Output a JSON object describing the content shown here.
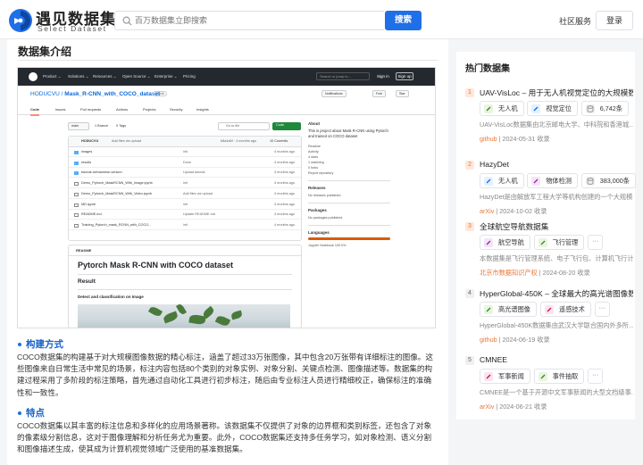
{
  "header": {
    "brand_cn": "遇见数据集",
    "brand_en": "Select Dataset",
    "search_placeholder": "百万数据集立即搜索",
    "search_button": "搜索",
    "community": "社区服务",
    "login": "登录"
  },
  "main": {
    "section_title": "数据集介绍",
    "github": {
      "menu": [
        "Product ⌄",
        "Solutions ⌄",
        "Resources ⌄",
        "Open Source ⌄",
        "Enterprise ⌄",
        "Pricing"
      ],
      "search": "Search or jump to...",
      "sign_in": "Sign in",
      "sign_up": "Sign up",
      "owner": "HODUCVU",
      "repo": "Mask_R-CNN_with_COCO_dataset",
      "visibility": "Public",
      "notifications": "Notifications",
      "fork": "Fork",
      "star": "Star",
      "tabs": [
        "Code",
        "Issues",
        "Pull requests",
        "Actions",
        "Projects",
        "Security",
        "Insights"
      ],
      "branch": "main",
      "branches": "1 Branch",
      "tags": "0 Tags",
      "goto_file": "Go to file",
      "code_button": "Code",
      "commit_author": "HODUCVU",
      "commit_msg": "Add files via upload",
      "commit_hash": "b8a4a5f · 4 months ago",
      "commits": "10 Commits",
      "files": [
        {
          "name": "images",
          "msg": "init",
          "time": "4 months ago"
        },
        {
          "name": "results",
          "msg": "Done",
          "time": "4 months ago"
        },
        {
          "name": "tutorial-vietnamese-version",
          "msg": "Upload tutorial",
          "time": "4 months ago"
        },
        {
          "name": "Demo_Pytorch_MaskRCNN_With_Image.ipynb",
          "msg": "init",
          "time": "4 months ago"
        },
        {
          "name": "Demo_Pytorch_MaskRCNN_With_Video.ipynb",
          "msg": "Add files via upload",
          "time": "4 months ago"
        },
        {
          "name": "MD.ipynb",
          "msg": "init",
          "time": "4 months ago"
        },
        {
          "name": "README.md",
          "msg": "Update README.md",
          "time": "4 months ago"
        },
        {
          "name": "Training_Pytorch_mask_RCNN_with_COCO...",
          "msg": "init",
          "time": "4 months ago"
        }
      ],
      "readme_tab": "README",
      "readme_title": "Pytorch Mask R-CNN with COCO dataset",
      "readme_result": "Result",
      "readme_detect": "Detect and classification on Image",
      "about_title": "About",
      "about_desc": "This is project about Mask R-CNN using Pytorch and trained on COCO dataset",
      "about_items": [
        "Readme",
        "Activity",
        "4 stars",
        "1 watching",
        "0 forks",
        "Report repository"
      ],
      "releases_title": "Releases",
      "releases_text": "No releases published",
      "packages_title": "Packages",
      "packages_text": "No packages published",
      "languages_title": "Languages",
      "language": "Jupyter Notebook 100.0%"
    },
    "h_build": "构建方式",
    "p_build": "COCO数据集的构建基于对大规模图像数据的精心标注，涵盖了超过33万张图像，其中包含20万张带有详细标注的图像。这些图像来自日常生活中常见的场景，标注内容包括80个类别的对象实例、对象分割、关键点检测、图像描述等。数据集的构建过程采用了多阶段的标注策略，首先通过自动化工具进行初步标注，随后由专业标注人员进行精细校正，确保标注的准确性和一致性。",
    "h_feature": "特点",
    "p_feature": "COCO数据集以其丰富的标注信息和多样化的应用场景著称。该数据集不仅提供了对象的边界框和类别标签，还包含了对象的像素级分割信息，这对于图像理解和分析任务尤为重要。此外，COCO数据集还支持多任务学习，如对象检测、语义分割和图像描述生成，使其成为计算机视觉领域广泛使用的基准数据集。"
  },
  "sidebar": {
    "title": "热门数据集",
    "items": [
      {
        "num": "1",
        "title": "UAV-VisLoc – 用于无人机视觉定位的大规模数据集",
        "tags": [
          "无人机",
          "视觉定位"
        ],
        "count": "6,742条",
        "desc": "UAV-VisLoc数据集由北京邮电大学、中科院和香港城...",
        "source": "github",
        "date": "2024-05-31 收录"
      },
      {
        "num": "2",
        "title": "HazyDet",
        "tags": [
          "无人机",
          "物体检测"
        ],
        "count": "383,000条",
        "desc": "HazyDet是由解放军工程大学等机构创建的一个大规模...",
        "source": "arXiv",
        "date": "2024-10-02 收录"
      },
      {
        "num": "3",
        "title": "全球航空导航数据集",
        "tags": [
          "航空导航",
          "飞行管理"
        ],
        "count": "",
        "desc": "本数据集是飞行管理系统、电子飞行包、计算机飞行计...",
        "source": "北京市数据知识产权",
        "date": "2024-08-20 收录"
      },
      {
        "num": "4",
        "title": "HyperGlobal-450K – 全球最大的高光谱图像数据集",
        "tags": [
          "高光谱图像",
          "遥感技术"
        ],
        "count": "",
        "desc": "HyperGlobal-450K数据集由武汉大学联合国内外多所...",
        "source": "github",
        "date": "2024-06-19 收录"
      },
      {
        "num": "5",
        "title": "CMNEE",
        "tags": [
          "军事新闻",
          "事件抽取"
        ],
        "count": "",
        "desc": "CMNEE是一个基于开源中文军事新闻的大型文档级事...",
        "source": "arXiv",
        "date": "2024-06-21 收录"
      }
    ]
  },
  "colors": {
    "accent": "#1f6fe8",
    "hot": "#e8773a",
    "heading": "#1a63c8"
  }
}
